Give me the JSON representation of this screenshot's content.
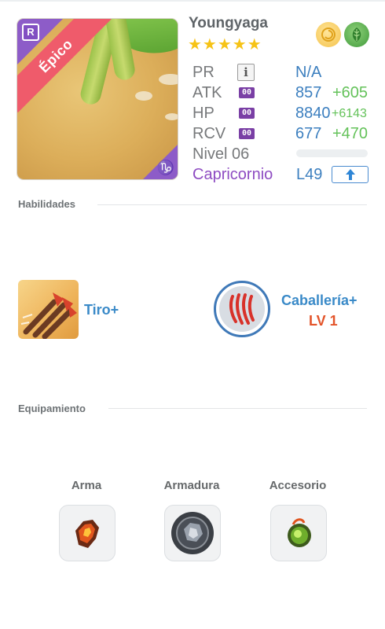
{
  "hero": {
    "name": "Youngyaga",
    "rarity": "Épico",
    "stars": "★★★★★",
    "star_count": 5,
    "class_badge": "R",
    "zodiac_symbol": "♑",
    "elements": [
      "sun-element-icon",
      "leaf-element-icon"
    ]
  },
  "stats": {
    "pr": {
      "label": "PR",
      "value": "N/A",
      "info_icon": "i"
    },
    "atk": {
      "label": "ATK",
      "badge": "00",
      "value": "857",
      "bonus": "+605"
    },
    "hp": {
      "label": "HP",
      "badge": "00",
      "value": "8840",
      "bonus": "+6143"
    },
    "rcv": {
      "label": "RCV",
      "badge": "00",
      "value": "677",
      "bonus": "+470"
    },
    "level": {
      "label": "Nivel 06",
      "progress": 0
    },
    "zodiac": "Capricornio",
    "max_level": "L49"
  },
  "skills": {
    "title": "Habilidades",
    "items": [
      {
        "name": "Tiro+",
        "icon": "arrows-icon"
      },
      {
        "name": "Caballería+",
        "level": "LV 1",
        "icon": "claw-marks-icon"
      }
    ]
  },
  "equipment": {
    "title": "Equipamiento",
    "slots": [
      {
        "label": "Arma",
        "icon": "weapon-gem-icon"
      },
      {
        "label": "Armadura",
        "icon": "armor-gem-icon"
      },
      {
        "label": "Accesorio",
        "icon": "accessory-gem-icon"
      }
    ]
  },
  "colors": {
    "rarity_ribbon": "#ef5b6b",
    "zodiac_purple": "#8e4cc2",
    "stat_blue": "#3c7fbf",
    "bonus_green": "#64c25a",
    "skill_level_orange": "#e3542a",
    "star_gold": "#f6c316"
  }
}
